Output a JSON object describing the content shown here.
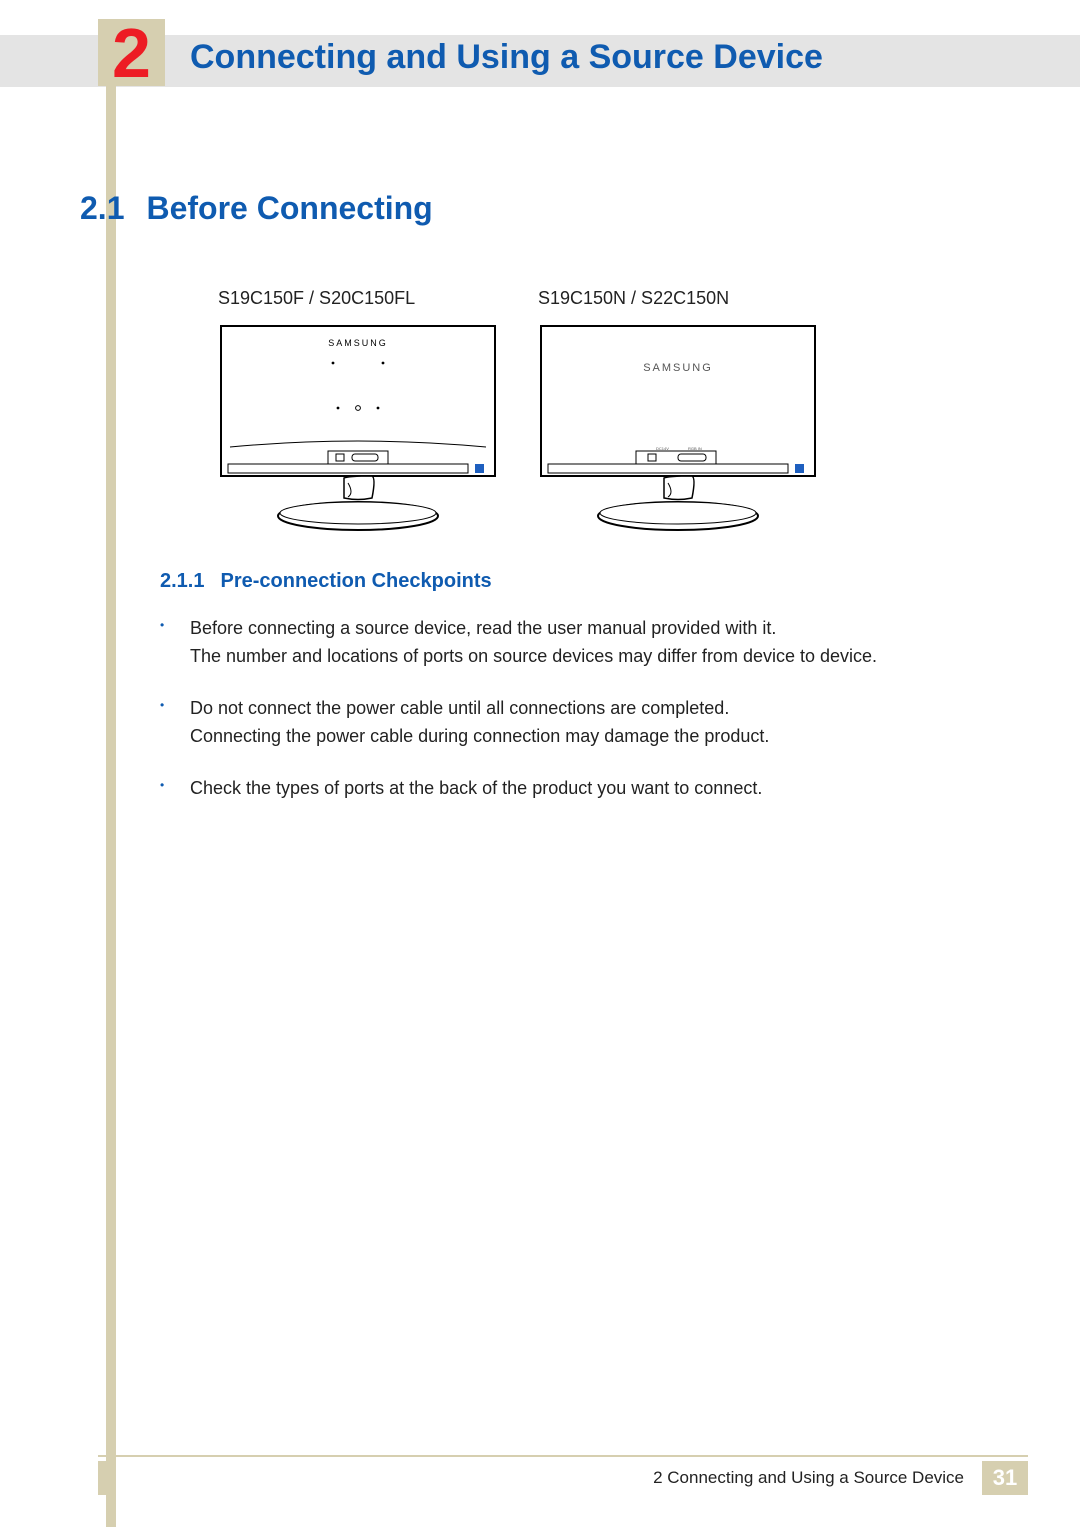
{
  "chapter": {
    "number": "2",
    "title": "Connecting and Using a Source Device"
  },
  "section": {
    "number": "2.1",
    "title": "Before Connecting"
  },
  "models": {
    "left_label": "S19C150F / S20C150FL",
    "right_label": "S19C150N / S22C150N",
    "brand": "SAMSUNG"
  },
  "subsection": {
    "number": "2.1.1",
    "title": "Pre-connection Checkpoints",
    "bullets": [
      {
        "line1": "Before connecting a source device, read the user manual provided with it.",
        "line2": "The number and locations of ports on source devices may differ from device to device."
      },
      {
        "line1": "Do not connect the power cable until all connections are completed.",
        "line2": "Connecting the power cable during connection may damage the product."
      },
      {
        "line1": "Check the types of ports at the back of the product you want to connect.",
        "line2": ""
      }
    ]
  },
  "footer": {
    "chapter_ref": "2 Connecting and Using a Source Device",
    "page": "31"
  }
}
